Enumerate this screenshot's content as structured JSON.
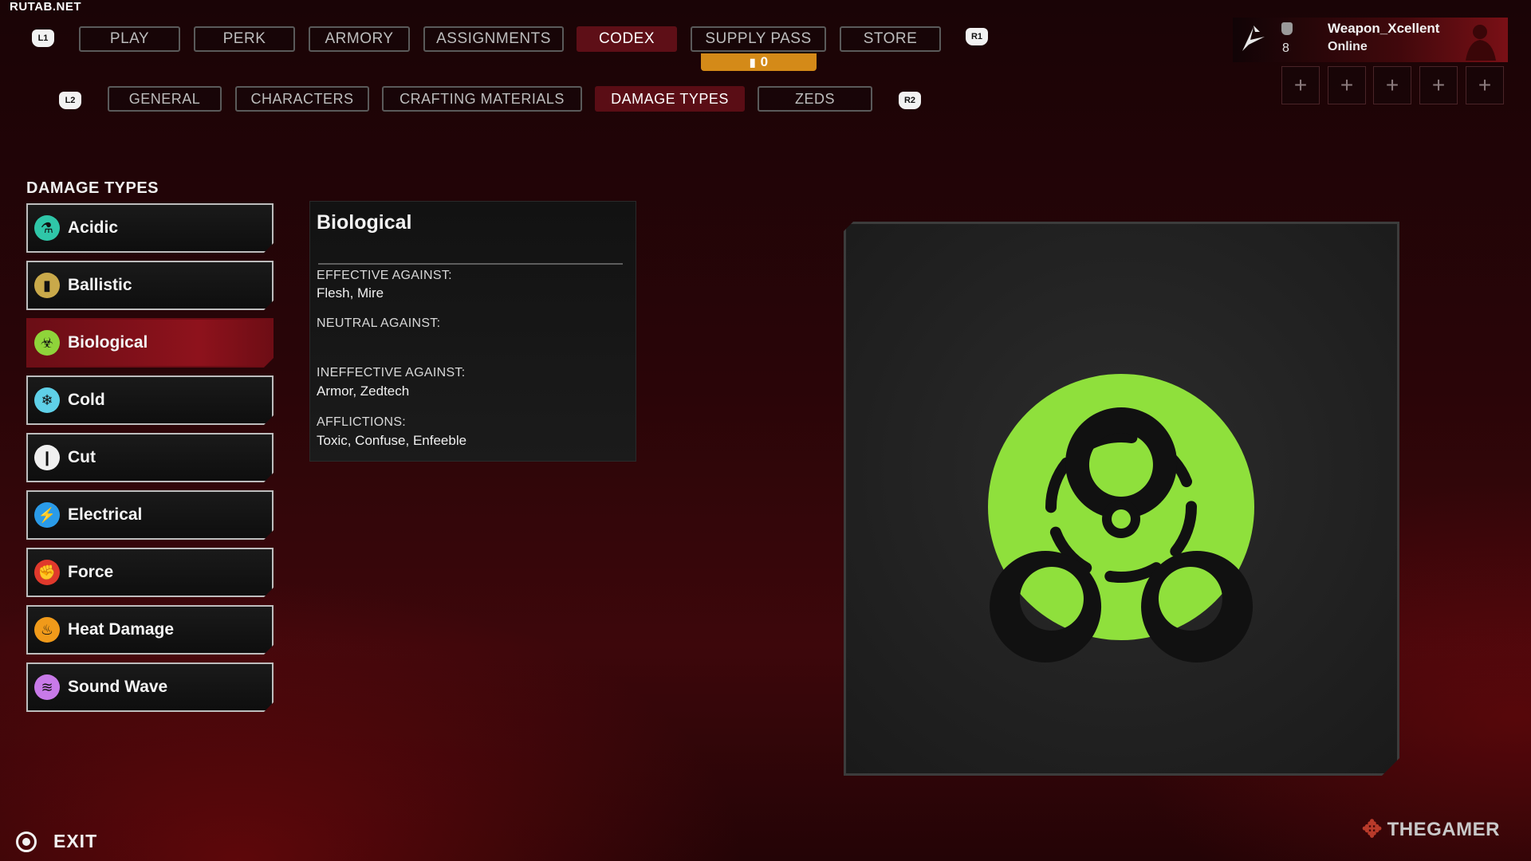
{
  "watermark_top": "RUTAB.NET",
  "nav": {
    "l1": "L1",
    "r1": "R1",
    "tabs": [
      "PLAY",
      "PERK",
      "ARMORY",
      "ASSIGNMENTS",
      "CODEX",
      "SUPPLY PASS",
      "STORE"
    ],
    "active_tab": "CODEX",
    "supply_pass_count": "0"
  },
  "subnav": {
    "l2": "L2",
    "r2": "R2",
    "tabs": [
      "GENERAL",
      "CHARACTERS",
      "CRAFTING MATERIALS",
      "DAMAGE TYPES",
      "ZEDS"
    ],
    "active_tab": "DAMAGE TYPES"
  },
  "profile": {
    "level": "8",
    "name": "Weapon_Xcellent",
    "status": "Online",
    "slots": [
      "+",
      "+",
      "+",
      "+",
      "+"
    ]
  },
  "damage_list": {
    "title": "DAMAGE TYPES",
    "items": [
      {
        "label": "Acidic",
        "icon": "flask-icon",
        "color": "#2fc6a8"
      },
      {
        "label": "Ballistic",
        "icon": "bullet-icon",
        "color": "#c9a94a"
      },
      {
        "label": "Biological",
        "icon": "biohazard-icon",
        "color": "#8fd43a"
      },
      {
        "label": "Cold",
        "icon": "snowflake-icon",
        "color": "#5fd0e8"
      },
      {
        "label": "Cut",
        "icon": "blade-icon",
        "color": "#f0f0f0"
      },
      {
        "label": "Electrical",
        "icon": "lightning-icon",
        "color": "#2a9be8"
      },
      {
        "label": "Force",
        "icon": "fist-icon",
        "color": "#e0392c"
      },
      {
        "label": "Heat Damage",
        "icon": "flame-icon",
        "color": "#f09a1a"
      },
      {
        "label": "Sound Wave",
        "icon": "soundwave-icon",
        "color": "#c87ae8"
      }
    ],
    "selected": "Biological"
  },
  "detail": {
    "title": "Biological",
    "effective_label": "EFFECTIVE AGAINST:",
    "effective_value": "Flesh, Mire",
    "neutral_label": "NEUTRAL AGAINST:",
    "neutral_value": "",
    "ineffective_label": "INEFFECTIVE AGAINST:",
    "ineffective_value": "Armor, Zedtech",
    "afflictions_label": "AFFLICTIONS:",
    "afflictions_value": "Toxic, Confuse, Enfeeble"
  },
  "image": {
    "icon": "biohazard-icon",
    "color": "#8fe03c"
  },
  "footer": {
    "exit_label": "EXIT",
    "brand": "THEGAMER"
  }
}
